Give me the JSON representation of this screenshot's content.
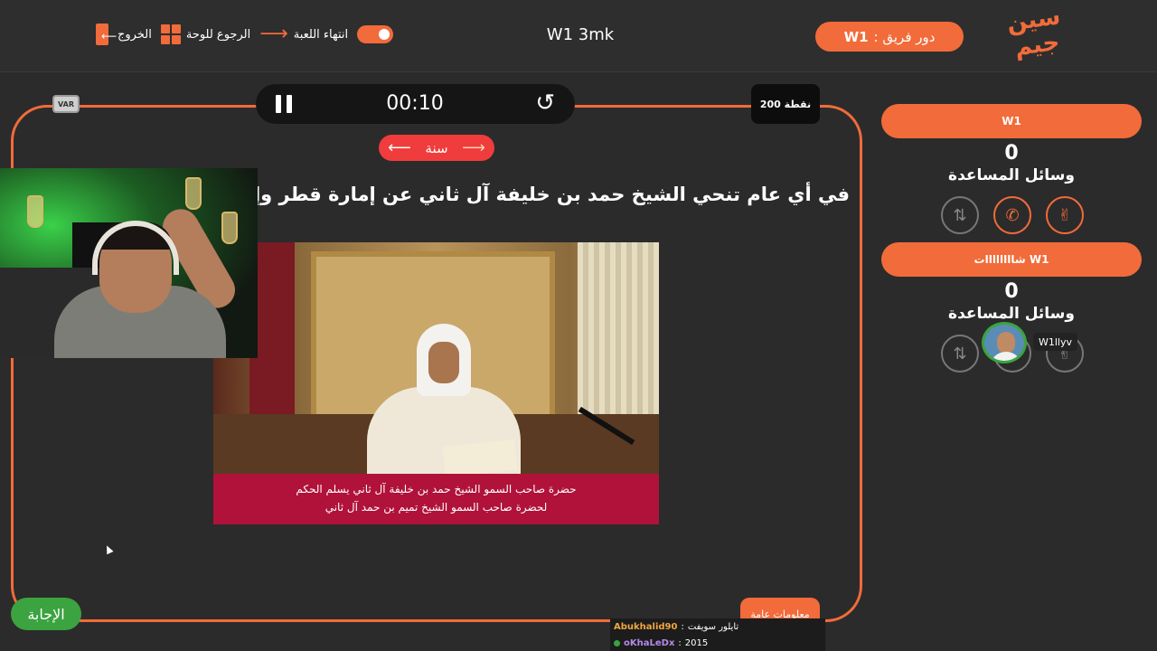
{
  "header": {
    "toggle_label": "انتهاء اللعبة",
    "back_label": "الرجوع للوحة",
    "exit_label": "الخروج",
    "game_title": "W1 3mk",
    "turn_prefix": "دور فريق :",
    "turn_team": "W1",
    "logo_line1": "سين",
    "logo_line2": "جيم"
  },
  "question_panel": {
    "var_label": "VAR",
    "timer": "00:10",
    "points": "200 نقطة",
    "category": "سنة",
    "question_text": "في أي عام تنحي الشيخ حمد بن خليفة آل ثاني عن إمارة قطر وإعلان خليفة آل ثاني أميراً للبلاد ؟",
    "caption_line1": "حضرة صاحب السمو الشيخ حمد بن خليفة آل ثاني يسلم الحكم",
    "caption_line2": "لحضرة صاحب السمو الشيخ تميم بن حمد آل ثاني",
    "answer_label": "الإجابة",
    "info_label": "معلومات عامة"
  },
  "chat": [
    {
      "user": "Abukhalid90",
      "message": "تايلور سويفت"
    },
    {
      "user": "oKhaLeDx",
      "message": "2015"
    }
  ],
  "teams": [
    {
      "name": "W1",
      "score": "0",
      "aids_label": "وسائل المساعدة",
      "aids": [
        {
          "icon": "hand-peace-icon",
          "active": true
        },
        {
          "icon": "phone-icon",
          "active": true
        },
        {
          "icon": "swap-icon",
          "active": false
        }
      ]
    },
    {
      "name": "W1 شاااااااات",
      "score": "0",
      "aids_label": "وسائل المساعدة",
      "aids": [
        {
          "icon": "hand-peace-icon",
          "active": false
        },
        {
          "icon": "phone-icon",
          "active": false
        },
        {
          "icon": "swap-icon",
          "active": false
        }
      ]
    }
  ],
  "overlay_user": "W1llyv",
  "colors": {
    "accent": "#f26b3a",
    "answer": "#3ba33f",
    "category": "#f03c3c",
    "background": "#2b2b2b"
  }
}
